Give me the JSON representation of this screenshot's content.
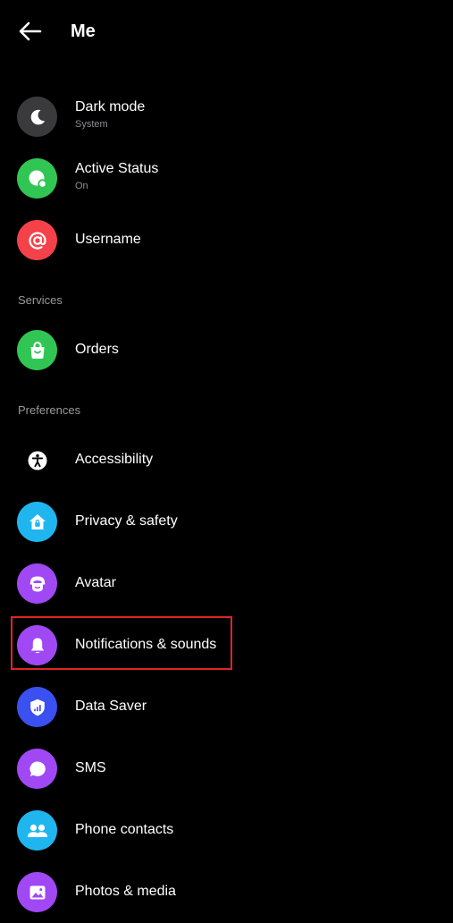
{
  "header": {
    "title": "Me",
    "back_icon": "arrow-left-icon"
  },
  "items_top": [
    {
      "label": "Dark mode",
      "sublabel": "System",
      "icon": "moon-icon",
      "color": "#3a3a3c"
    },
    {
      "label": "Active Status",
      "sublabel": "On",
      "icon": "active-status-icon",
      "color": "#31c653"
    },
    {
      "label": "Username",
      "icon": "at-sign-icon",
      "color": "#f5414a"
    }
  ],
  "sections": [
    {
      "title": "Services"
    },
    {
      "title": "Preferences"
    }
  ],
  "services": [
    {
      "label": "Orders",
      "icon": "shopping-bag-icon",
      "color": "#31c653"
    }
  ],
  "preferences": [
    {
      "label": "Accessibility",
      "icon": "accessibility-icon",
      "color": "#000000"
    },
    {
      "label": "Privacy & safety",
      "icon": "privacy-house-icon",
      "color": "#1fb6f0"
    },
    {
      "label": "Avatar",
      "icon": "avatar-face-icon",
      "color": "#a148f5"
    },
    {
      "label": "Notifications & sounds",
      "icon": "bell-icon",
      "color": "#a148f5"
    },
    {
      "label": "Data Saver",
      "icon": "shield-signal-icon",
      "color": "#3a50f0"
    },
    {
      "label": "SMS",
      "icon": "chat-bubble-icon",
      "color": "#a148f5"
    },
    {
      "label": "Phone contacts",
      "icon": "people-icon",
      "color": "#1fb6f0"
    },
    {
      "label": "Photos & media",
      "icon": "image-icon",
      "color": "#a148f5"
    }
  ],
  "highlight_color": "#e02424"
}
